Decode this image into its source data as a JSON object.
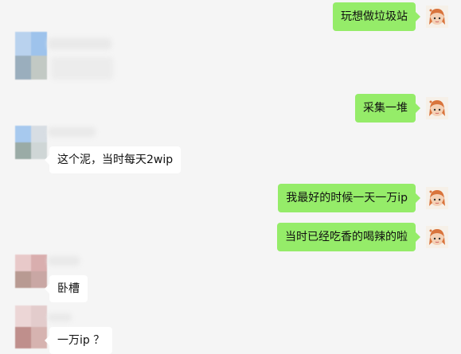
{
  "messages": [
    {
      "side": "right",
      "text": "玩想做垃圾站"
    },
    {
      "side": "left",
      "text": ""
    },
    {
      "side": "right",
      "text": "采集一堆"
    },
    {
      "side": "left",
      "text": "这个泥，当时每天2wip"
    },
    {
      "side": "right",
      "text": "我最好的时候一天一万ip"
    },
    {
      "side": "right",
      "text": "当时已经吃香的喝辣的啦"
    },
    {
      "side": "left",
      "text": "卧槽"
    },
    {
      "side": "left",
      "text": "一万ip ？"
    }
  ],
  "colors": {
    "background": "#f5f5f5",
    "self_bubble": "#95ec69",
    "other_bubble": "#ffffff"
  },
  "icons": {
    "self_avatar": "cartoon-girl-avatar-icon",
    "other_avatar": "pixelated-avatar-icon"
  }
}
